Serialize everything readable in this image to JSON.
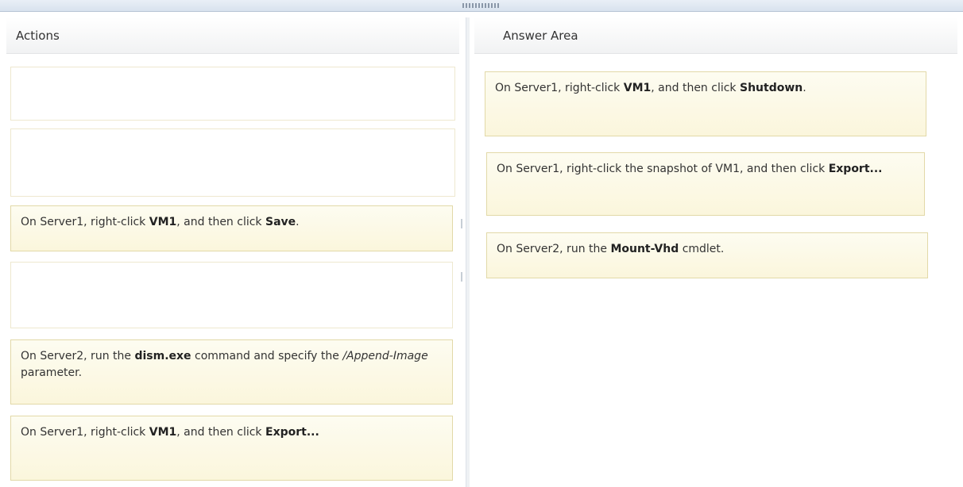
{
  "actions": {
    "header": "Actions",
    "items": [
      {
        "segments": []
      },
      {
        "segments": []
      },
      {
        "segments": [
          {
            "text": "On Server1, right-click ",
            "style": "normal"
          },
          {
            "text": "VM1",
            "style": "bold"
          },
          {
            "text": ", and then click ",
            "style": "normal"
          },
          {
            "text": "Save",
            "style": "bold"
          },
          {
            "text": ".",
            "style": "normal"
          }
        ]
      },
      {
        "segments": []
      },
      {
        "segments": [
          {
            "text": "On Server2, run the ",
            "style": "normal"
          },
          {
            "text": "dism.exe",
            "style": "bold"
          },
          {
            "text": " command and specify the ",
            "style": "normal"
          },
          {
            "text": "/Append-Image",
            "style": "italic"
          },
          {
            "text": " parameter.",
            "style": "normal"
          }
        ]
      },
      {
        "segments": [
          {
            "text": "On Server1, right-click ",
            "style": "normal"
          },
          {
            "text": "VM1",
            "style": "bold"
          },
          {
            "text": ", and then click ",
            "style": "normal"
          },
          {
            "text": "Export...",
            "style": "bold"
          }
        ]
      }
    ]
  },
  "answer": {
    "header": "Answer Area",
    "items": [
      {
        "segments": [
          {
            "text": "On Server1, right-click ",
            "style": "normal"
          },
          {
            "text": "VM1",
            "style": "bold"
          },
          {
            "text": ", and then click ",
            "style": "normal"
          },
          {
            "text": "Shutdown",
            "style": "bold"
          },
          {
            "text": ".",
            "style": "normal"
          }
        ]
      },
      {
        "segments": [
          {
            "text": "On Server1, right-click the snapshot of VM1, and then click ",
            "style": "normal"
          },
          {
            "text": "Export...",
            "style": "bold"
          }
        ]
      },
      {
        "segments": [
          {
            "text": "On Server2, run the ",
            "style": "normal"
          },
          {
            "text": "Mount-Vhd",
            "style": "bold"
          },
          {
            "text": " cmdlet.",
            "style": "normal"
          }
        ]
      }
    ]
  }
}
